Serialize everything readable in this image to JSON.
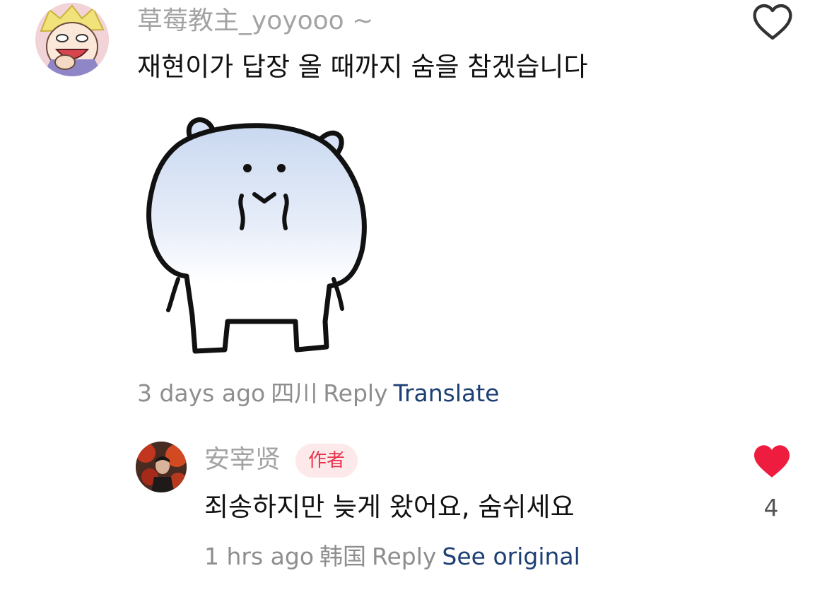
{
  "comment": {
    "username": "草莓教主_yoyooo ~",
    "text": "재현이가 답장 올 때까지 숨을 참겠습니다",
    "sticker_icon": "white-bear-sticker",
    "time": "3 days ago",
    "location": "四川",
    "reply_label": "Reply",
    "translate_label": "Translate",
    "like_icon": "heart-outline-icon"
  },
  "reply": {
    "username": "安宰贤",
    "badge": "作者",
    "text": "죄송하지만 늦게 왔어요, 숨쉬세요",
    "like_count": "4",
    "like_icon": "heart-filled-icon",
    "time": "1 hrs ago",
    "location": "韩国",
    "reply_label": "Reply",
    "see_original_label": "See original"
  },
  "colors": {
    "link": "#1d3f73",
    "like_red": "#ee1c3f",
    "meta_gray": "#8e8e8e",
    "badge_bg": "#fde9ea",
    "badge_text": "#e8334a"
  }
}
